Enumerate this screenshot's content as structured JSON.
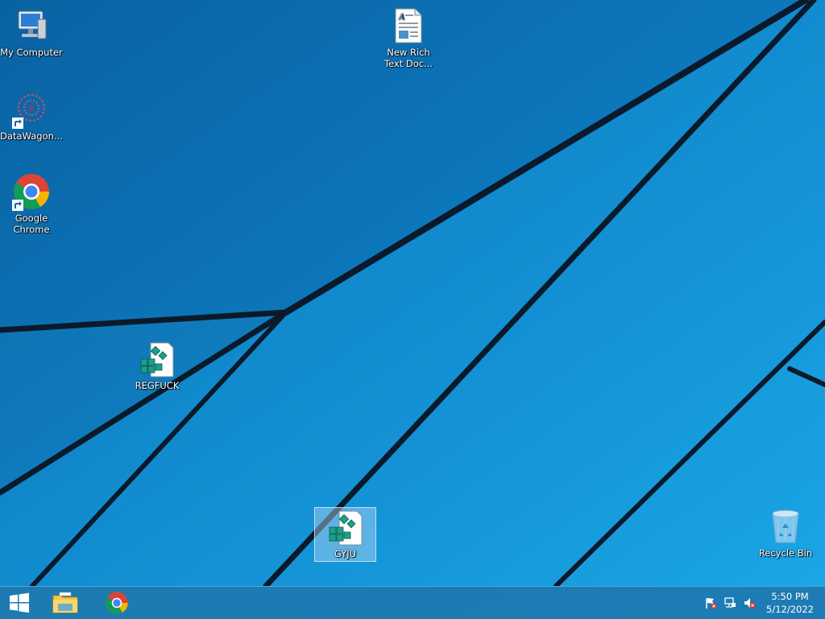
{
  "desktop": {
    "icons": [
      {
        "label": "My Computer",
        "icon": "computer-icon"
      },
      {
        "label": "DataWagon...",
        "icon": "datawagon-icon"
      },
      {
        "label": "Google Chrome",
        "icon": "chrome-icon"
      },
      {
        "label": "New Rich Text Doc...",
        "icon": "rtf-document-icon"
      },
      {
        "label": "REGFUCK",
        "icon": "registry-file-icon"
      },
      {
        "label": "GYJU",
        "icon": "registry-file-icon",
        "selected": true
      },
      {
        "label": "Recycle Bin",
        "icon": "recycle-bin-icon"
      }
    ]
  },
  "taskbar": {
    "start": {
      "icon": "windows-logo-icon"
    },
    "pinned": [
      {
        "icon": "file-explorer-icon"
      },
      {
        "icon": "chrome-icon"
      }
    ],
    "tray": [
      {
        "icon": "action-center-flag-icon"
      },
      {
        "icon": "network-icon"
      },
      {
        "icon": "volume-muted-icon"
      }
    ],
    "clock": {
      "time": "5:50 PM",
      "date": "5/12/2022"
    }
  },
  "colors": {
    "accent": "#1e78af",
    "wallpaper": "#1596d8"
  }
}
